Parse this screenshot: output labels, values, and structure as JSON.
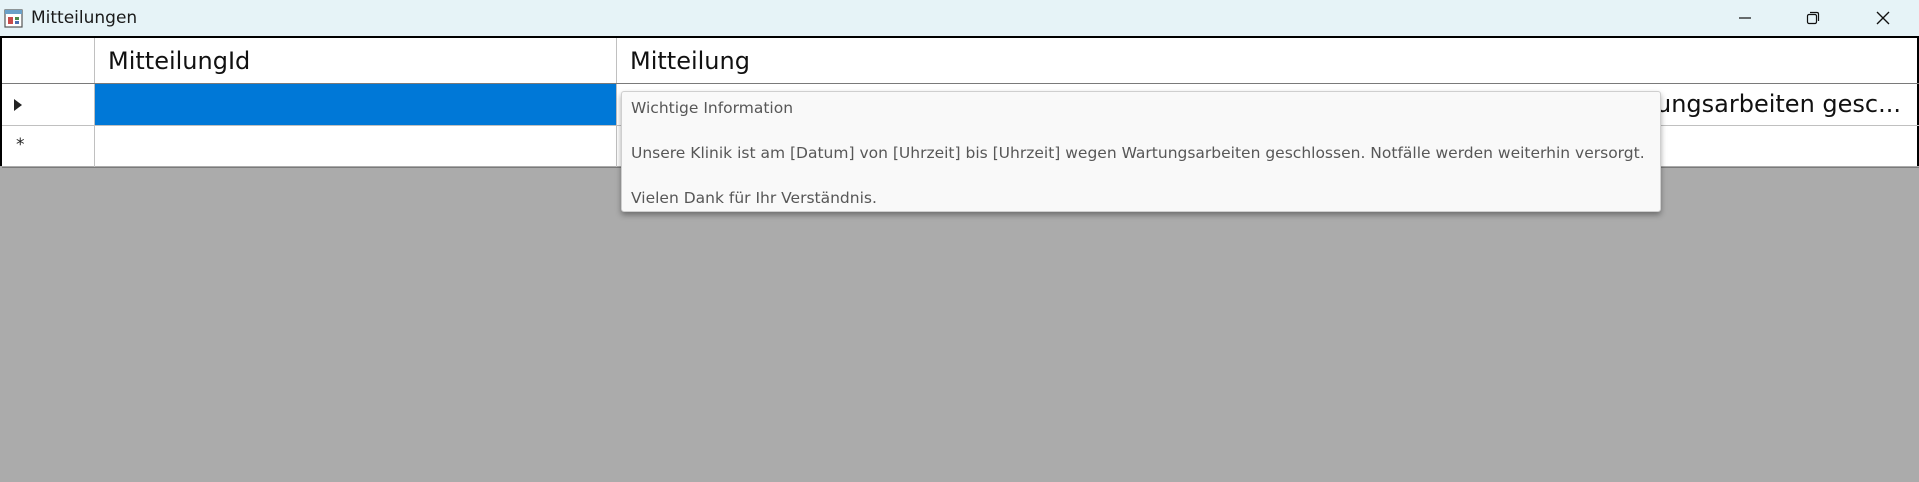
{
  "window": {
    "title": "Mitteilungen",
    "app_icon": "app-window-icon",
    "controls": {
      "minimize_icon": "minimize-icon",
      "maximize_icon": "restore-icon",
      "close_icon": "close-icon"
    }
  },
  "grid": {
    "columns": [
      "MitteilungId",
      "Mitteilung"
    ],
    "rows": [
      {
        "indicator": "current-row-arrow",
        "MitteilungId": "",
        "Mitteilung": "ungsarbeiten gesc...",
        "selected": true
      },
      {
        "indicator": "*",
        "MitteilungId": "",
        "Mitteilung": ""
      }
    ],
    "selection_color": "#0078d7"
  },
  "tooltip": {
    "lines": [
      "Wichtige Information",
      "Unsere Klinik ist am [Datum] von [Uhrzeit] bis [Uhrzeit] wegen Wartungsarbeiten geschlossen. Notfälle werden weiterhin versorgt.",
      "Vielen Dank für Ihr Verständnis."
    ]
  },
  "colors": {
    "titlebar": "#e6f3f7",
    "background": "#ababab"
  }
}
